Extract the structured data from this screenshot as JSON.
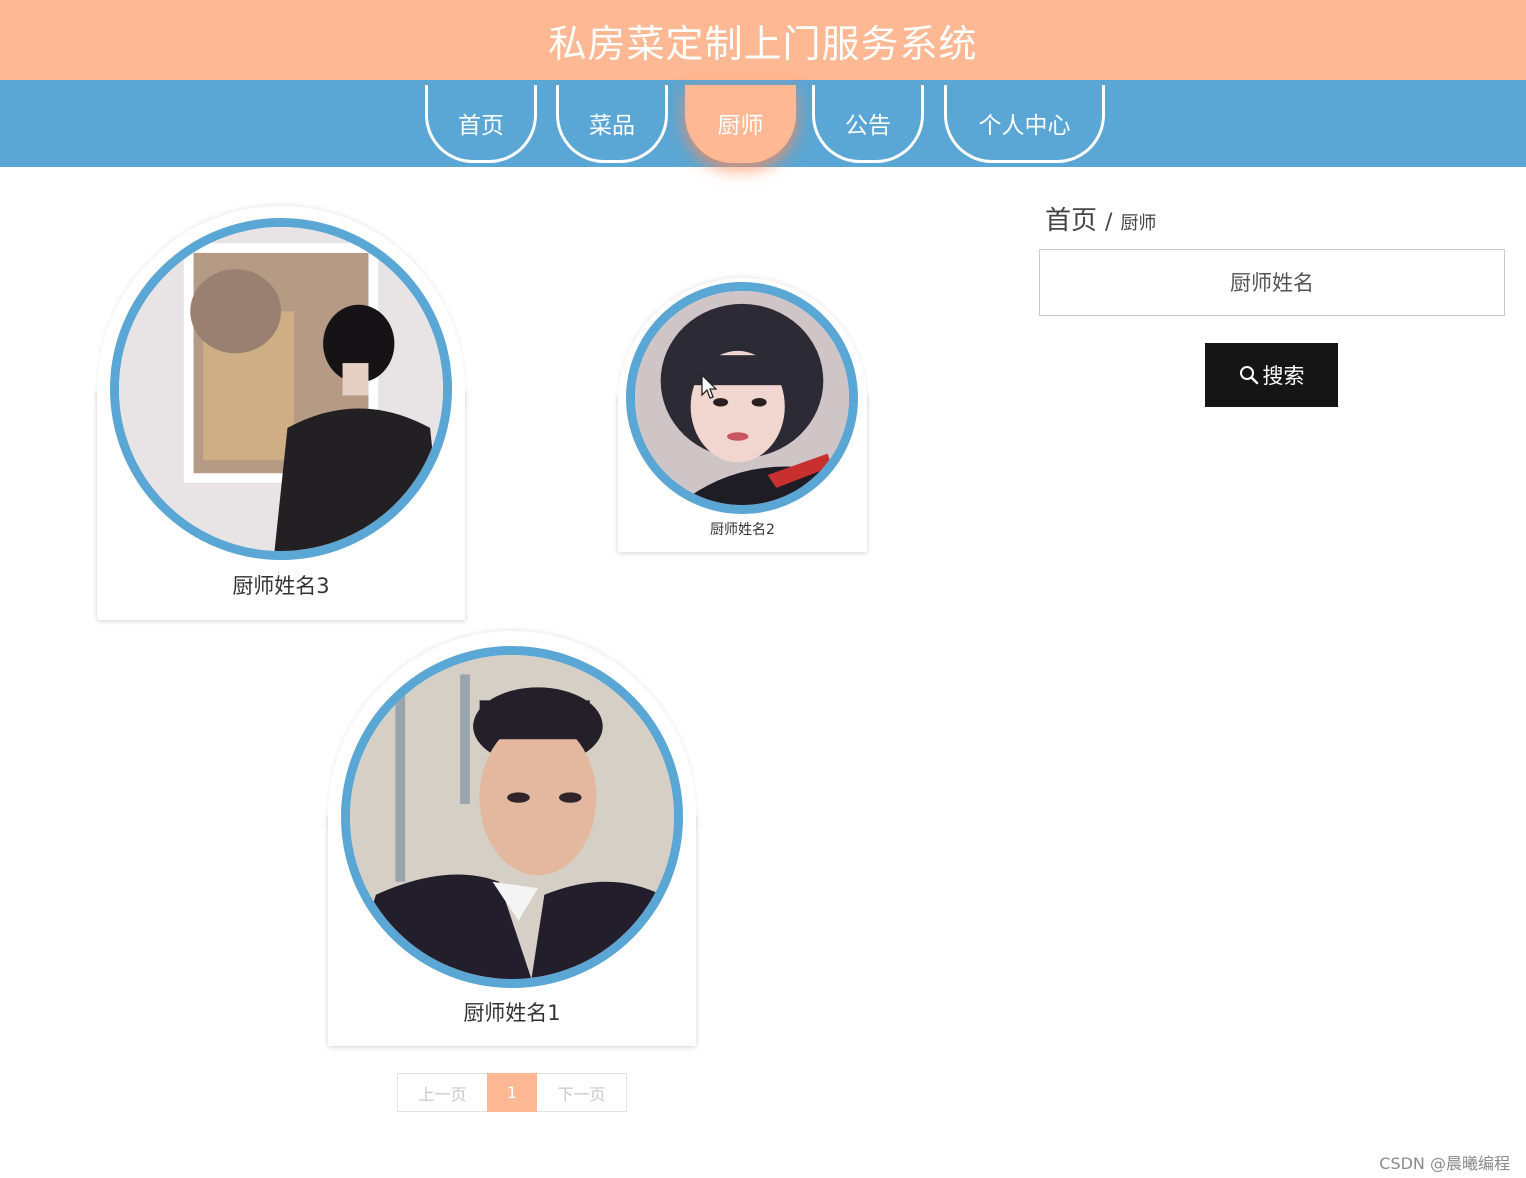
{
  "header": {
    "title": "私房菜定制上门服务系统"
  },
  "nav": {
    "items": [
      {
        "label": "首页"
      },
      {
        "label": "菜品"
      },
      {
        "label": "厨师"
      },
      {
        "label": "公告"
      },
      {
        "label": "个人中心"
      }
    ],
    "active": "厨师"
  },
  "chefs": [
    {
      "name": "厨师姓名3",
      "photo": "chef-photo-3"
    },
    {
      "name": "厨师姓名2",
      "photo": "chef-photo-2"
    },
    {
      "name": "厨师姓名1",
      "photo": "chef-photo-1"
    }
  ],
  "breadcrumb": {
    "home": "首页",
    "separator": "/",
    "current": "厨师"
  },
  "search": {
    "placeholder": "厨师姓名",
    "value": "",
    "button_label": "搜索",
    "button_icon": "search-icon"
  },
  "pagination": {
    "prev_label": "上一页",
    "current_page": "1",
    "next_label": "下一页"
  },
  "watermark": "CSDN @晨曦编程",
  "colors": {
    "header_bg": "#feb893",
    "nav_bg": "#5aa6d4",
    "photo_ring": "#5aa6d4",
    "button_bg": "#151515",
    "active_page": "#feb893"
  }
}
